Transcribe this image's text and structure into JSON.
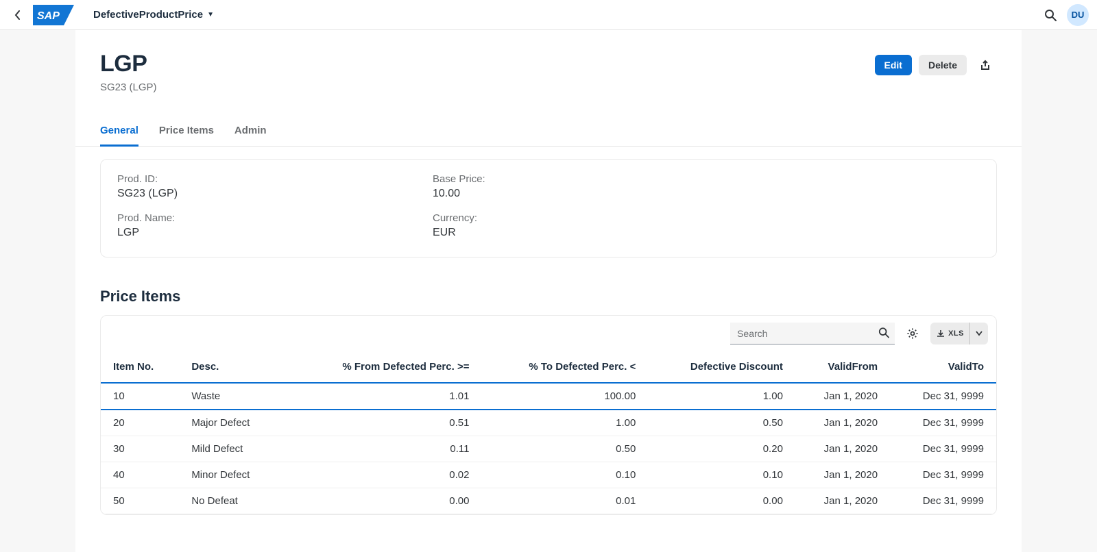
{
  "shell": {
    "app_title": "DefectiveProductPrice",
    "avatar_initials": "DU"
  },
  "header": {
    "title": "LGP",
    "subtitle": "SG23 (LGP)",
    "actions": {
      "edit_label": "Edit",
      "delete_label": "Delete"
    }
  },
  "tabs": [
    "General",
    "Price Items",
    "Admin"
  ],
  "general": {
    "prod_id_label": "Prod. ID:",
    "prod_id_value": "SG23 (LGP)",
    "prod_name_label": "Prod. Name:",
    "prod_name_value": "LGP",
    "base_price_label": "Base Price:",
    "base_price_value": "10.00",
    "currency_label": "Currency:",
    "currency_value": "EUR"
  },
  "price_items": {
    "section_title": "Price Items",
    "search_placeholder": "Search",
    "export_label": "XLS",
    "columns": [
      "Item No.",
      "Desc.",
      "% From Defected Perc. >=",
      "% To Defected Perc. <",
      "Defective Discount",
      "ValidFrom",
      "ValidTo"
    ],
    "rows": [
      {
        "item_no": "10",
        "desc": "Waste",
        "from": "1.01",
        "to": "100.00",
        "discount": "1.00",
        "valid_from": "Jan 1, 2020",
        "valid_to": "Dec 31, 9999",
        "selected": true
      },
      {
        "item_no": "20",
        "desc": "Major Defect",
        "from": "0.51",
        "to": "1.00",
        "discount": "0.50",
        "valid_from": "Jan 1, 2020",
        "valid_to": "Dec 31, 9999",
        "selected": false
      },
      {
        "item_no": "30",
        "desc": "Mild Defect",
        "from": "0.11",
        "to": "0.50",
        "discount": "0.20",
        "valid_from": "Jan 1, 2020",
        "valid_to": "Dec 31, 9999",
        "selected": false
      },
      {
        "item_no": "40",
        "desc": "Minor Defect",
        "from": "0.02",
        "to": "0.10",
        "discount": "0.10",
        "valid_from": "Jan 1, 2020",
        "valid_to": "Dec 31, 9999",
        "selected": false
      },
      {
        "item_no": "50",
        "desc": "No Defeat",
        "from": "0.00",
        "to": "0.01",
        "discount": "0.00",
        "valid_from": "Jan 1, 2020",
        "valid_to": "Dec 31, 9999",
        "selected": false
      }
    ]
  }
}
